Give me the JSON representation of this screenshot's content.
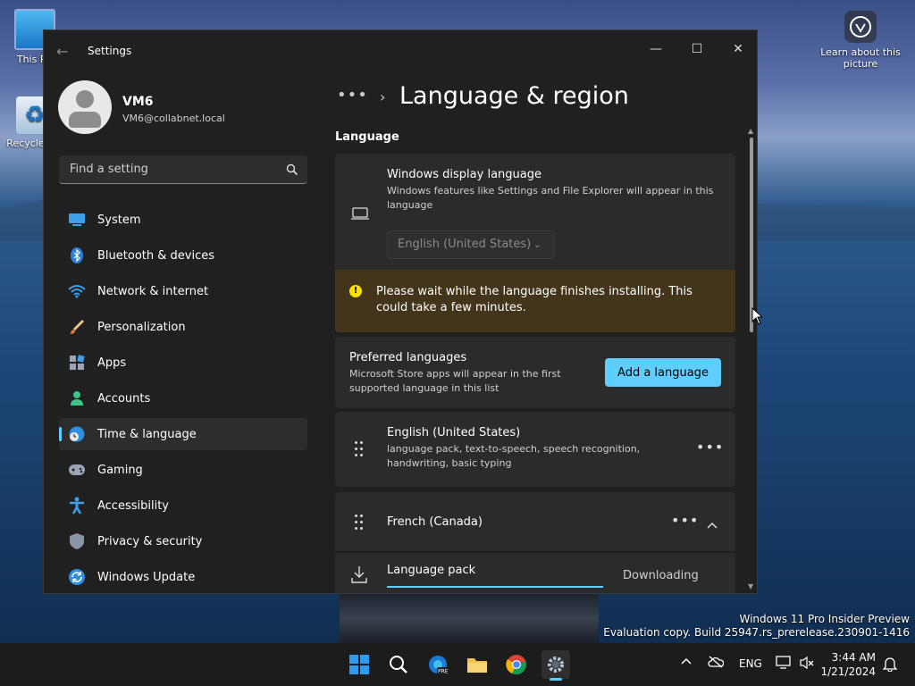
{
  "desktop": {
    "icons": [
      {
        "label": "This PC"
      },
      {
        "label": "Recycle Bin"
      }
    ],
    "learn_label": "Learn about this picture",
    "watermark_line1": "Windows 11 Pro Insider Preview",
    "watermark_line2": "Evaluation copy. Build 25947.rs_prerelease.230901-1416"
  },
  "window": {
    "title": "Settings",
    "controls": {
      "minimize": "—",
      "maximize": "☐",
      "close": "✕"
    }
  },
  "profile": {
    "name": "VM6",
    "email": "VM6@collabnet.local"
  },
  "search": {
    "placeholder": "Find a setting"
  },
  "sidebar": {
    "items": [
      {
        "label": "System",
        "icon": "system-icon"
      },
      {
        "label": "Bluetooth & devices",
        "icon": "bluetooth-icon"
      },
      {
        "label": "Network & internet",
        "icon": "wifi-icon"
      },
      {
        "label": "Personalization",
        "icon": "brush-icon"
      },
      {
        "label": "Apps",
        "icon": "apps-icon"
      },
      {
        "label": "Accounts",
        "icon": "accounts-icon"
      },
      {
        "label": "Time & language",
        "icon": "globe-clock-icon",
        "active": true
      },
      {
        "label": "Gaming",
        "icon": "gamepad-icon"
      },
      {
        "label": "Accessibility",
        "icon": "accessibility-icon"
      },
      {
        "label": "Privacy & security",
        "icon": "shield-icon"
      },
      {
        "label": "Windows Update",
        "icon": "update-icon"
      }
    ]
  },
  "breadcrumb": {
    "dots": "•••",
    "separator": "›",
    "title": "Language & region"
  },
  "language": {
    "section_title": "Language",
    "display": {
      "title": "Windows display language",
      "description": "Windows features like Settings and File Explorer will appear in this language",
      "selected": "English (United States)"
    },
    "warning": "Please wait while the language finishes installing. This could take a few minutes.",
    "preferred": {
      "title": "Preferred languages",
      "description": "Microsoft Store apps will appear in the first supported language in this list",
      "button": "Add a language"
    },
    "entries": [
      {
        "name": "English (United States)",
        "features": "language pack, text-to-speech, speech recognition, handwriting, basic typing"
      },
      {
        "name": "French (Canada)"
      }
    ],
    "download": {
      "label": "Language pack",
      "status": "Downloading",
      "progress": 1.0
    }
  },
  "taskbar": {
    "tray_language": "ENG",
    "time": "3:44 AM",
    "date": "1/21/2024"
  },
  "colors": {
    "accent": "#60cdff",
    "window_bg": "#202020",
    "card_bg": "#2b2b2b",
    "warning_bg": "#433519",
    "warning_icon": "#fce100"
  }
}
